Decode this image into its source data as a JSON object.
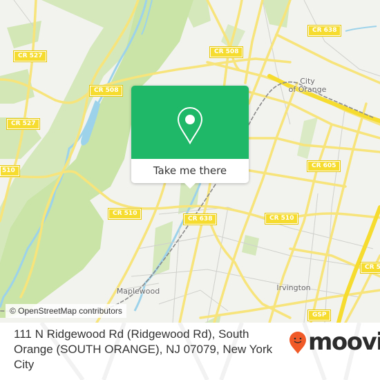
{
  "map": {
    "road_shields": [
      {
        "id": "cr527-top",
        "label": "CR 527"
      },
      {
        "id": "cr508-left",
        "label": "CR 508"
      },
      {
        "id": "cr527-mid",
        "label": "CR 527"
      },
      {
        "id": "cr510-left-edge",
        "label": "510"
      },
      {
        "id": "cr510-center",
        "label": "CR 510"
      },
      {
        "id": "cr508-top",
        "label": "CR 508"
      },
      {
        "id": "cr638-top",
        "label": "CR 638"
      },
      {
        "id": "cr605",
        "label": "CR 605"
      },
      {
        "id": "cr638-center",
        "label": "CR 638"
      },
      {
        "id": "cr510-right",
        "label": "CR 510"
      },
      {
        "id": "cr5-edge",
        "label": "CR 5"
      },
      {
        "id": "gsp",
        "label": "GSP"
      }
    ],
    "places": [
      {
        "id": "city-of-orange",
        "label": "City\nof Orange"
      },
      {
        "id": "maplewood",
        "label": "Maplewood"
      },
      {
        "id": "irvington",
        "label": "Irvington"
      }
    ],
    "attribution": "© OpenStreetMap contributors"
  },
  "popup": {
    "icon": "location-pin-icon",
    "action_label": "Take me there",
    "color": "#1fb868"
  },
  "footer": {
    "address": "111 N Ridgewood Rd (Ridgewood Rd), South Orange (SOUTH ORANGE), NJ 07079, New York City",
    "brand": "moovit",
    "brand_color": "#f05a28"
  }
}
